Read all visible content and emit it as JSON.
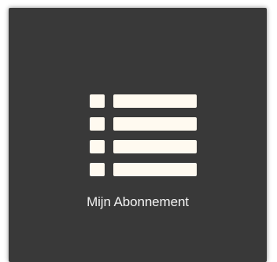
{
  "tile": {
    "label": "Mijn Abonnement",
    "icon": "list-icon",
    "background_color": "#393939",
    "icon_color": "#fffaf0",
    "text_color": "#f2f2f2"
  }
}
